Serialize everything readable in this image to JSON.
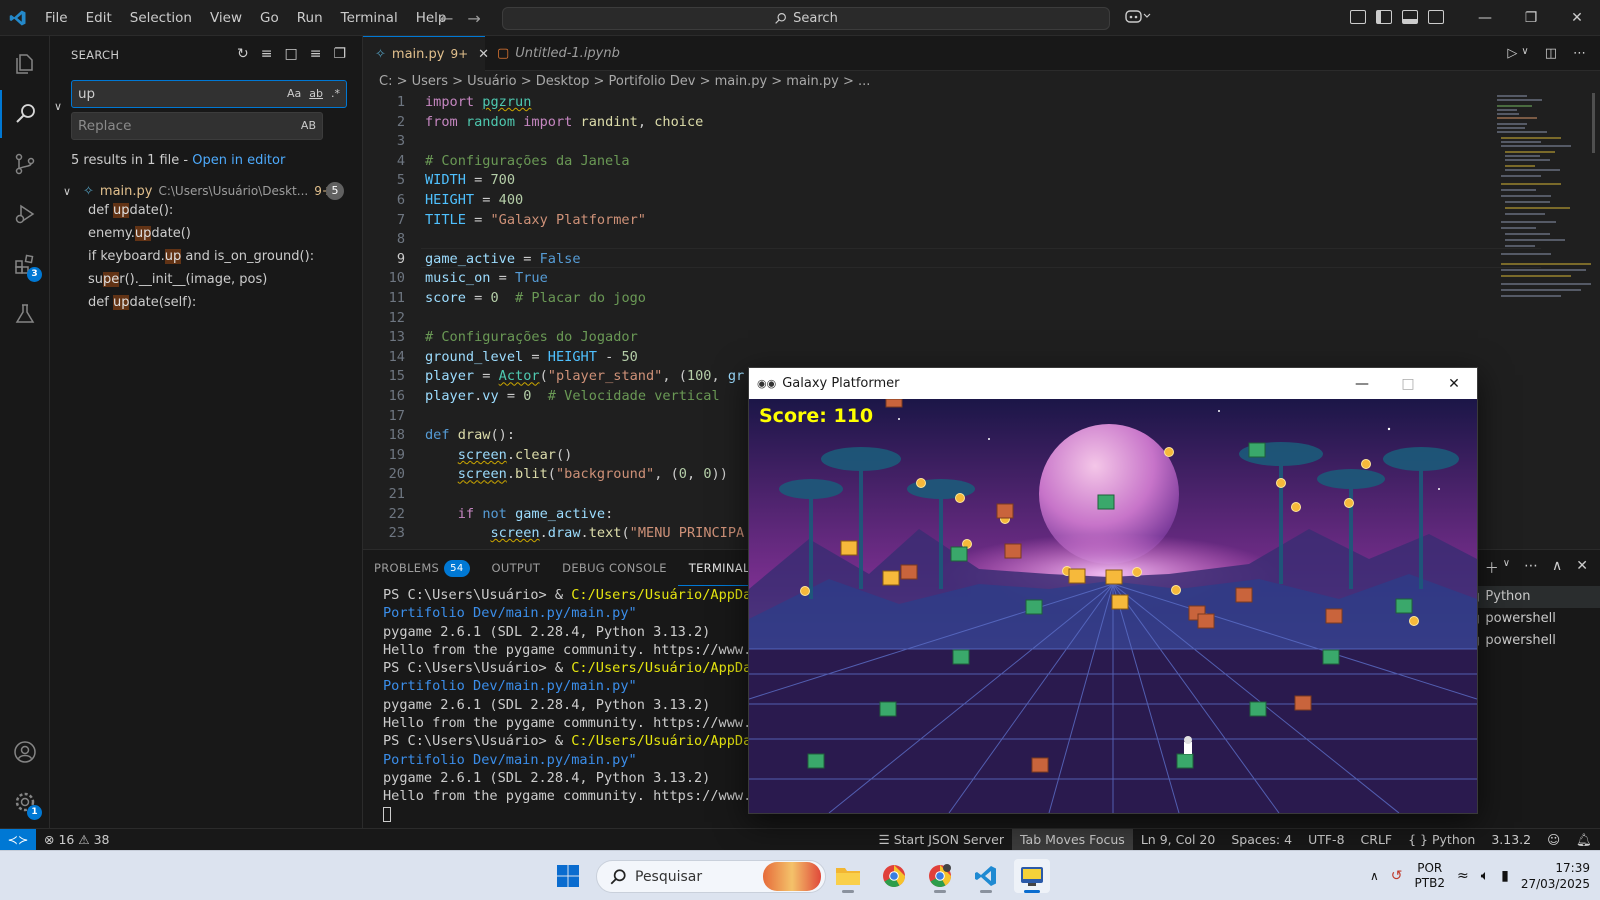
{
  "menu": [
    "File",
    "Edit",
    "Selection",
    "View",
    "Go",
    "Run",
    "Terminal",
    "Help"
  ],
  "command_center": {
    "placeholder": "Search"
  },
  "activity": {
    "extensions_badge": "3",
    "manage_badge": "1"
  },
  "sidebar": {
    "title": "SEARCH",
    "search_value": "up",
    "search_opts": [
      "Aa",
      "ab",
      ".*"
    ],
    "replace_placeholder": "Replace",
    "replace_ab": "AB",
    "summary": "5 results in 1 file - ",
    "open_in_editor": "Open in editor",
    "file_name": "main.py",
    "file_path": "C:\\Users\\Usuário\\Deskt...",
    "file_problems": "9+",
    "file_count": "5",
    "matches": [
      {
        "pre": "def ",
        "hit": "up",
        "post": "date():"
      },
      {
        "pre": "enemy.",
        "hit": "up",
        "post": "date()"
      },
      {
        "pre": "if keyboard.",
        "hit": "up",
        "post": " and is_on_ground():"
      },
      {
        "pre": "su",
        "hit": "pe",
        "post": "r().__init__(image, pos)"
      },
      {
        "pre": "def ",
        "hit": "up",
        "post": "date(self):"
      }
    ]
  },
  "tabs": [
    {
      "label": "main.py",
      "badge": "9+"
    },
    {
      "label": "Untitled-1.ipynb"
    }
  ],
  "breadcrumb": "C: > Users > Usuário > Desktop > Portifolio Dev > main.py > main.py > ...",
  "editor": {
    "current_line": 9,
    "line_numbers": [
      "1",
      "2",
      "3",
      "4",
      "5",
      "6",
      "7",
      "8",
      "9",
      "10",
      "11",
      "12",
      "13",
      "14",
      "15",
      "16",
      "17",
      "18",
      "19",
      "20",
      "21",
      "22",
      "23"
    ]
  },
  "panel": {
    "tabs": [
      "PROBLEMS",
      "OUTPUT",
      "DEBUG CONSOLE",
      "TERMINAL"
    ],
    "problems_count": "54",
    "terminal_lines": [
      {
        "type": "cmd",
        "prompt": "PS C:\\Users\\Usuário> & ",
        "cmd": "C:/Users/Usuário/AppData/L"
      },
      {
        "type": "path",
        "text": "Portifolio Dev/main.py/main.py\""
      },
      {
        "type": "out",
        "text": "pygame 2.6.1 (SDL 2.28.4, Python 3.13.2)"
      },
      {
        "type": "out",
        "text": "Hello from the pygame community. https://www.pyga"
      },
      {
        "type": "cmd",
        "prompt": "PS C:\\Users\\Usuário> & ",
        "cmd": "C:/Users/Usuário/AppData/L"
      },
      {
        "type": "path",
        "text": "Portifolio Dev/main.py/main.py\""
      },
      {
        "type": "out",
        "text": "pygame 2.6.1 (SDL 2.28.4, Python 3.13.2)"
      },
      {
        "type": "out",
        "text": "Hello from the pygame community. https://www.pyga"
      },
      {
        "type": "cmd",
        "prompt": "PS C:\\Users\\Usuário> & ",
        "cmd": "C:/Users/Usuário/AppData/L"
      },
      {
        "type": "path",
        "text": "Portifolio Dev/main.py/main.py\""
      },
      {
        "type": "out",
        "text": "pygame 2.6.1 (SDL 2.28.4, Python 3.13.2)"
      },
      {
        "type": "out",
        "text": "Hello from the pygame community. https://www.pyga"
      }
    ],
    "terminals": [
      "Python",
      "powershell",
      "powershell"
    ]
  },
  "statusbar": {
    "errors": "16",
    "warnings": "38",
    "json_server": "Start JSON Server",
    "tab_focus": "Tab Moves Focus",
    "position": "Ln 9, Col 20",
    "spaces": "Spaces: 4",
    "encoding": "UTF-8",
    "eol": "CRLF",
    "language": "Python",
    "version": "3.13.2"
  },
  "game": {
    "title": "Galaxy Platformer",
    "score": "Score: 110"
  },
  "taskbar": {
    "search": "Pesquisar",
    "lang1": "POR",
    "lang2": "PTB2",
    "time": "17:39",
    "date": "27/03/2025"
  },
  "colors": {
    "accent": "#0078d4",
    "score": "#ffff00",
    "highlight": "#623315"
  }
}
